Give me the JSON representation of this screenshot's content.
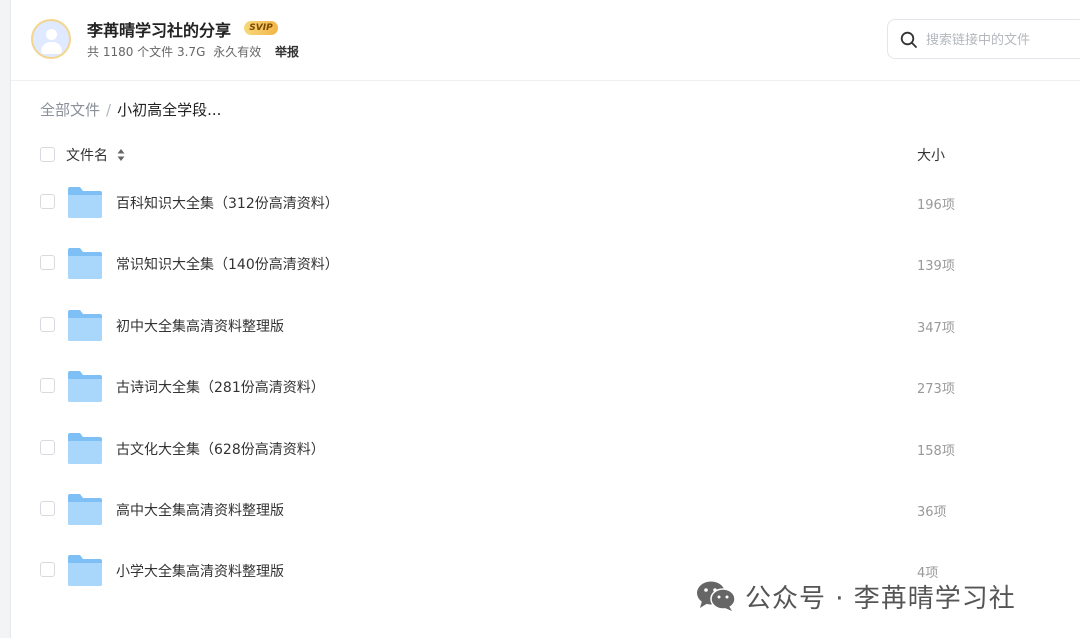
{
  "share": {
    "title": "李苒晴学习社的分享",
    "badge": "SVIP",
    "file_summary": "共 1180 个文件 3.7G",
    "validity": "永久有效",
    "report_label": "举报"
  },
  "search": {
    "placeholder": "搜索链接中的文件",
    "value": ""
  },
  "breadcrumb": {
    "root": "全部文件",
    "separator": "/",
    "current": "小初高全学段..."
  },
  "table": {
    "name_header": "文件名",
    "size_header": "大小",
    "rows": [
      {
        "name": "百科知识大全集（312份高清资料）",
        "size": "196项",
        "icon": "folder-icon"
      },
      {
        "name": "常识知识大全集（140份高清资料）",
        "size": "139项",
        "icon": "folder-icon"
      },
      {
        "name": "初中大全集高清资料整理版",
        "size": "347项",
        "icon": "folder-icon"
      },
      {
        "name": "古诗词大全集（281份高清资料）",
        "size": "273项",
        "icon": "folder-icon"
      },
      {
        "name": "古文化大全集（628份高清资料）",
        "size": "158项",
        "icon": "folder-icon"
      },
      {
        "name": "高中大全集高清资料整理版",
        "size": "36项",
        "icon": "folder-icon"
      },
      {
        "name": "小学大全集高清资料整理版",
        "size": "4项",
        "icon": "folder-icon"
      }
    ]
  },
  "watermark": {
    "text": "公众号 · 李苒晴学习社",
    "icon": "wechat-icon"
  },
  "colors": {
    "folder": "#7ec0f5",
    "svip_badge": "#f2b548",
    "page_bg": "#f3f4f6"
  }
}
